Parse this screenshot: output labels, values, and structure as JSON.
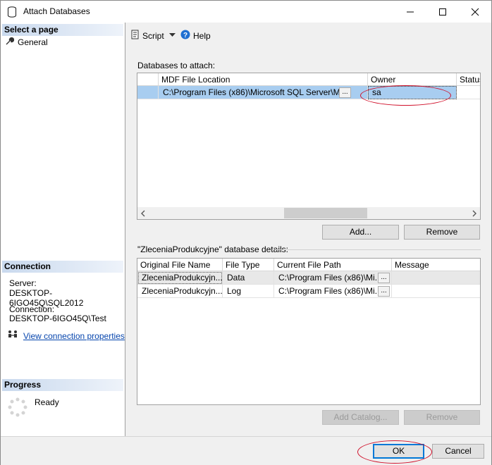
{
  "window": {
    "title": "Attach Databases",
    "icon": "database-icon"
  },
  "left": {
    "select_page": "Select a page",
    "pages": [
      {
        "label": "General",
        "icon": "wrench-icon"
      }
    ],
    "connection_header": "Connection",
    "server_label": "Server:",
    "server_value": "DESKTOP-6IGO45Q\\SQL2012",
    "connection_label": "Connection:",
    "connection_value": "DESKTOP-6IGO45Q\\Test",
    "view_props_link": "View connection properties",
    "progress_header": "Progress",
    "progress_status": "Ready"
  },
  "toolbar": {
    "script_label": "Script",
    "help_label": "Help"
  },
  "attach": {
    "section_label": "Databases to attach:",
    "columns": [
      "MDF File Location",
      "Owner",
      "Status"
    ],
    "rows": [
      {
        "mdf": "C:\\Program Files (x86)\\Microsoft SQL Server\\M...",
        "owner": "sa",
        "status": ""
      }
    ],
    "browse_label": "...",
    "add_label": "Add...",
    "remove_label": "Remove"
  },
  "details": {
    "section_label": "\"ZleceniaProdukcyjne\" database details:",
    "columns": [
      "Original File Name",
      "File Type",
      "Current File Path",
      "Message"
    ],
    "rows": [
      {
        "name": "ZleceniaProdukcyjn...",
        "type": "Data",
        "path": "C:\\Program Files (x86)\\Mi...",
        "message": ""
      },
      {
        "name": "ZleceniaProdukcyjn...",
        "type": "Log",
        "path": "C:\\Program Files (x86)\\Mi...",
        "message": ""
      }
    ],
    "browse_label": "...",
    "add_catalog_label": "Add Catalog...",
    "remove_label": "Remove"
  },
  "footer": {
    "ok_label": "OK",
    "cancel_label": "Cancel"
  },
  "colors": {
    "selection": "#a8cdf0",
    "highlight_oval": "#d0112b",
    "link": "#0645ad",
    "default_button_border": "#0078d7"
  }
}
